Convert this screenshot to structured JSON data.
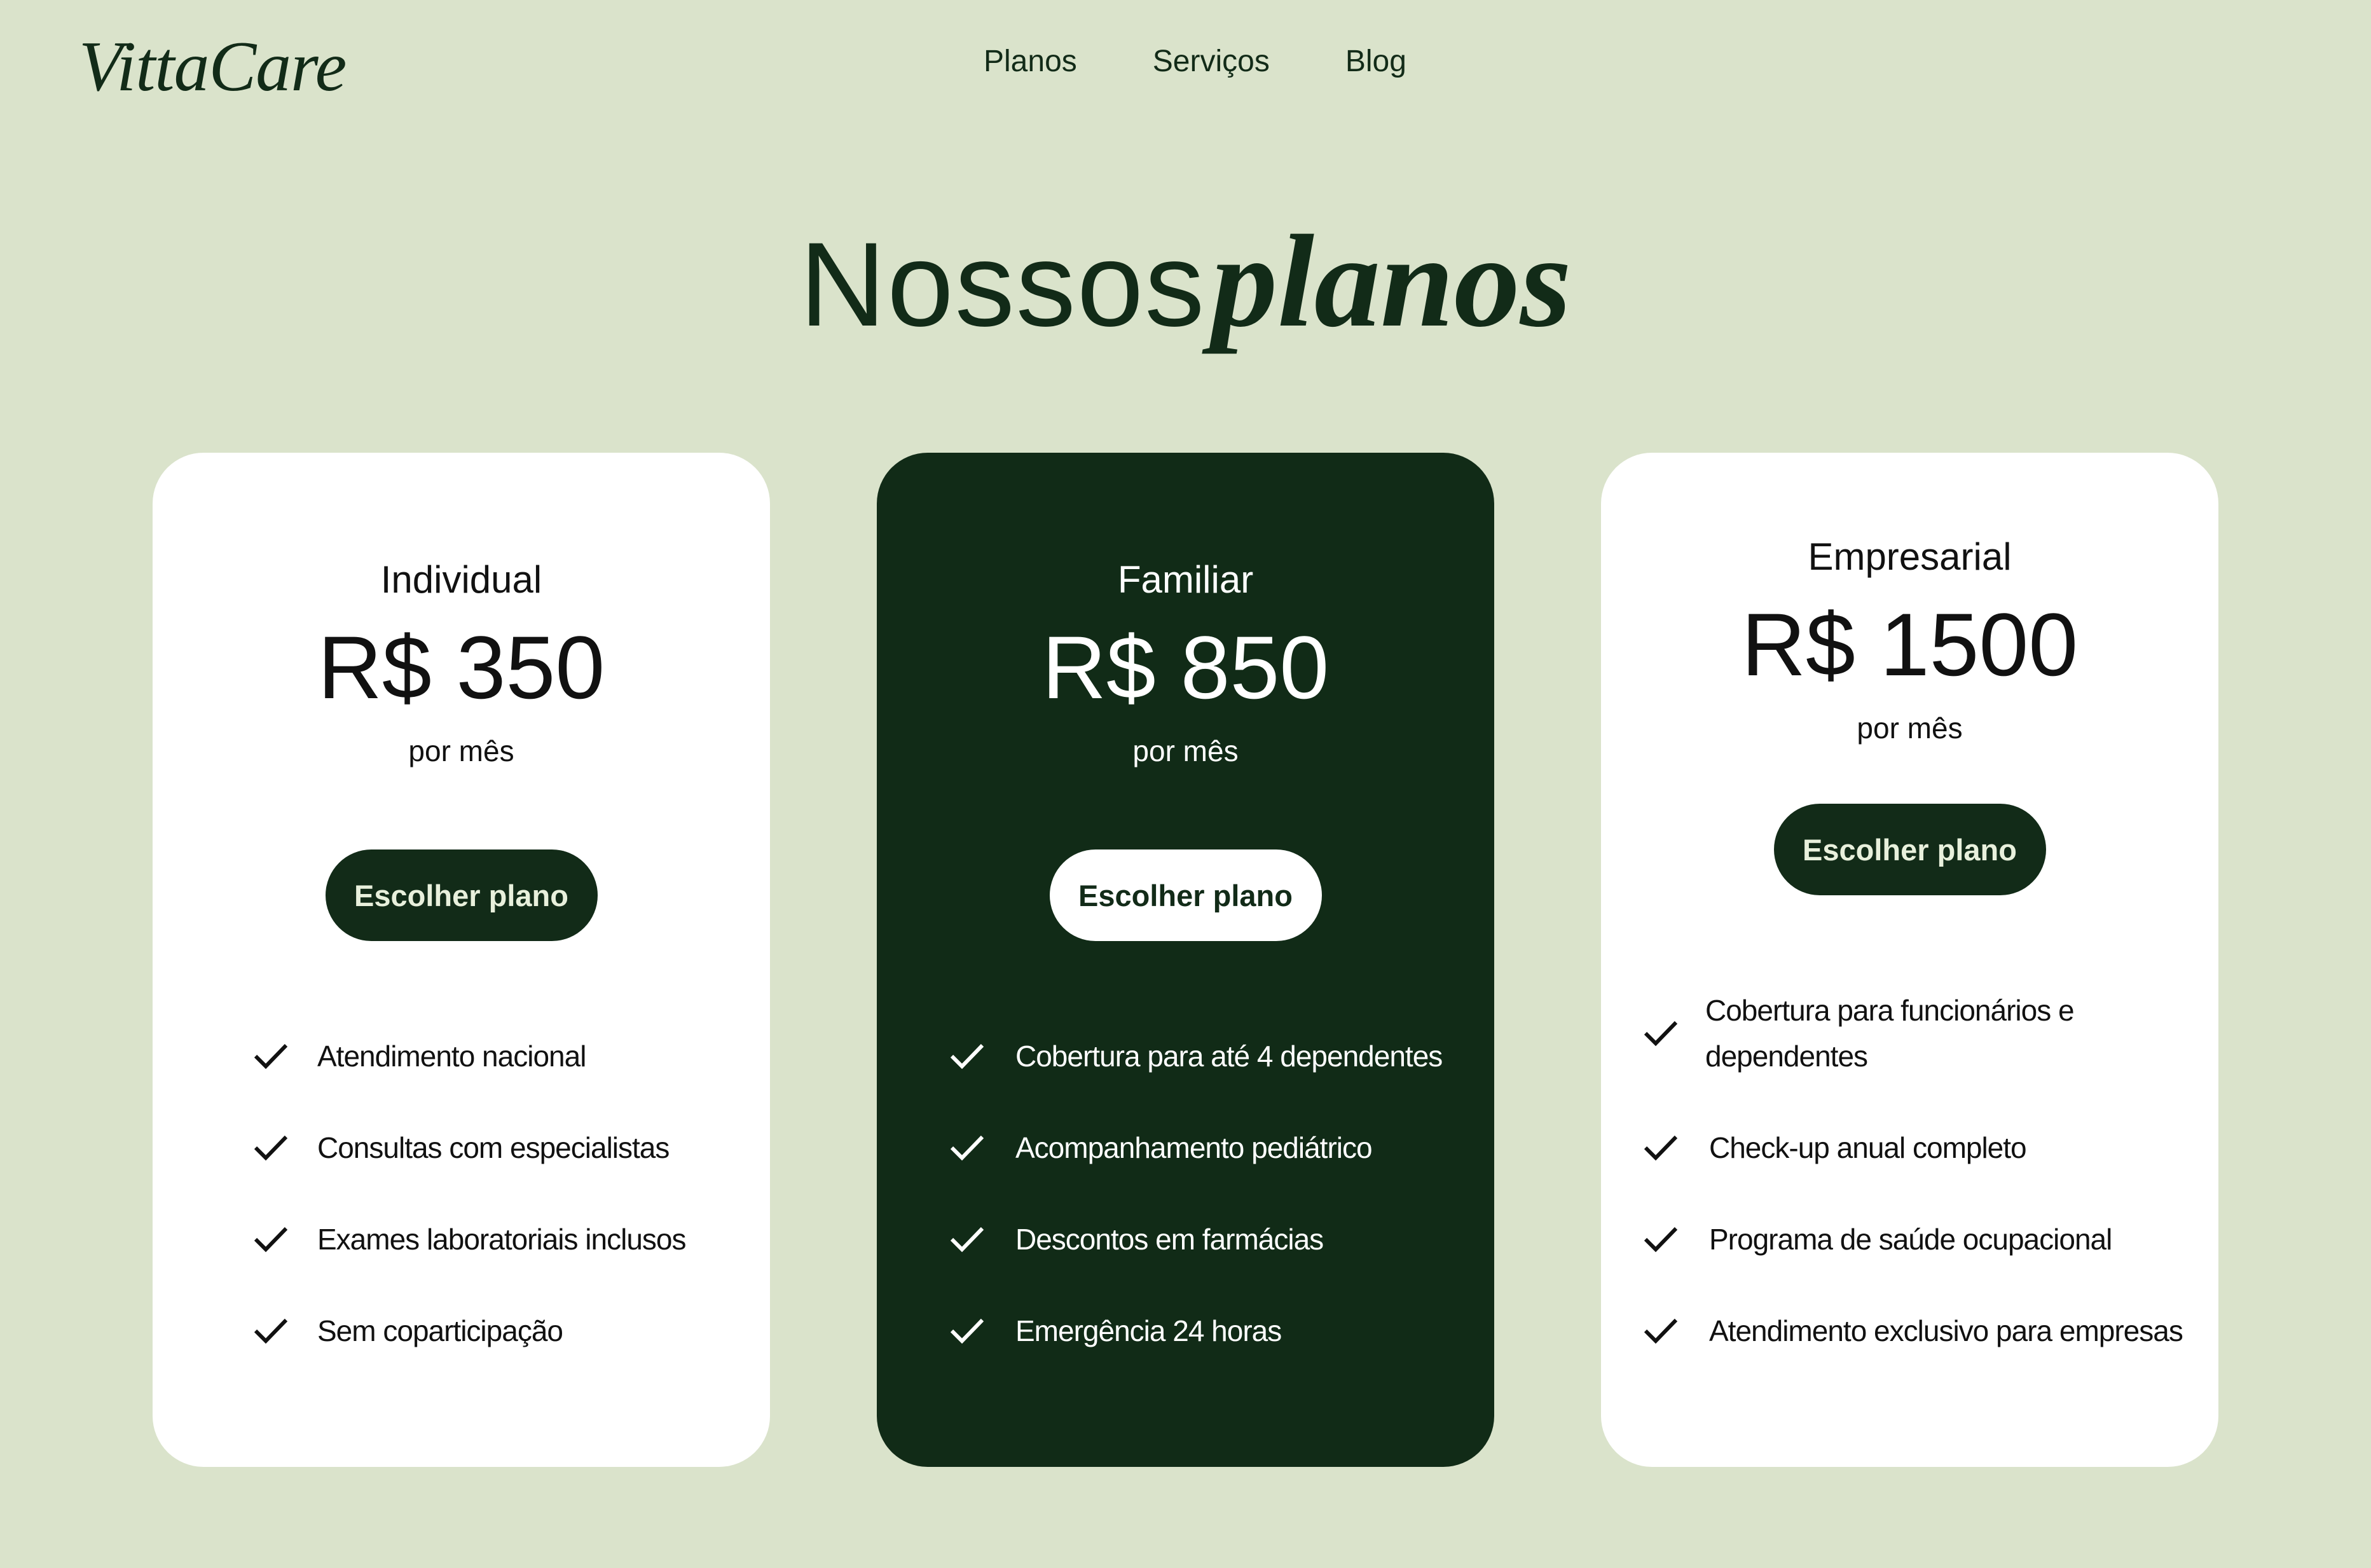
{
  "brand": {
    "logo": "VittaCare"
  },
  "nav": {
    "items": [
      "Planos",
      "Serviços",
      "Blog"
    ]
  },
  "heading": {
    "light": "Nossos",
    "bold": "planos"
  },
  "plans": [
    {
      "name": "Individual",
      "price": "R$ 350",
      "period": "por mês",
      "button": "Escolher plano",
      "features": [
        "Atendimento nacional",
        "Consultas com especialistas",
        "Exames laboratoriais inclusos",
        "Sem coparticipação"
      ]
    },
    {
      "name": "Familiar",
      "price": "R$ 850",
      "period": "por mês",
      "button": "Escolher plano",
      "features": [
        "Cobertura para até 4 dependentes",
        "Acompanhamento pediátrico",
        "Descontos em farmácias",
        "Emergência 24 horas"
      ]
    },
    {
      "name": "Empresarial",
      "price": "R$ 1500",
      "period": "por mês",
      "button": "Escolher plano",
      "features": [
        "Cobertura para funcionários e",
        "dependentes",
        "Check-up anual completo",
        "Programa de saúde ocupacional",
        "Atendimento exclusivo para empresas"
      ]
    }
  ],
  "colors": {
    "background": "#dae3cb",
    "dark_green": "#112b17",
    "white": "#ffffff"
  }
}
